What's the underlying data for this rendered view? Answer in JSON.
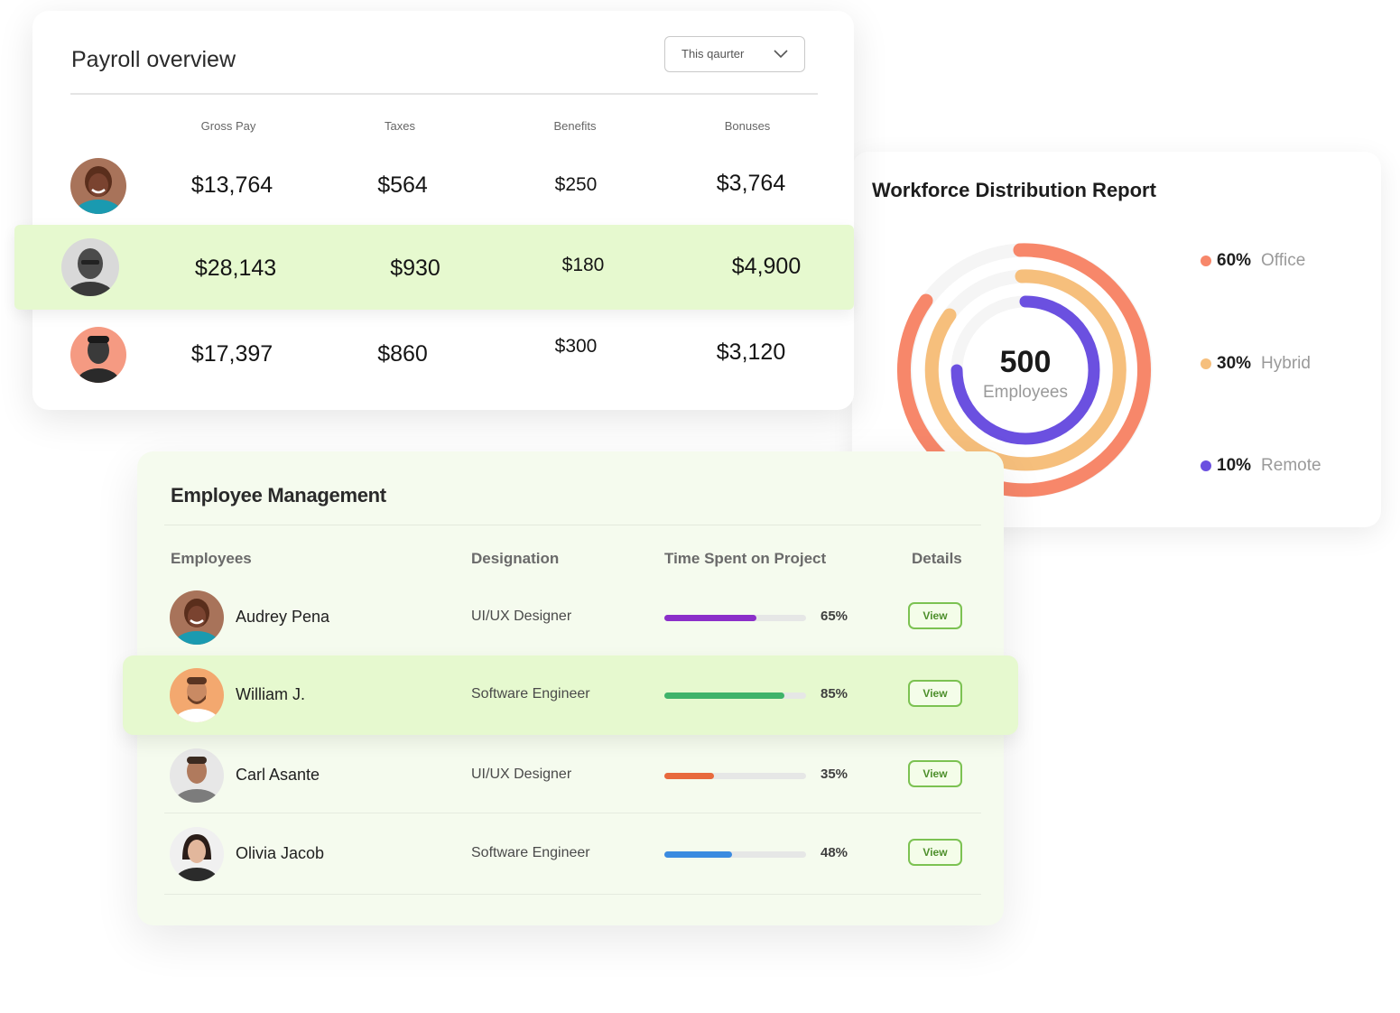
{
  "payroll": {
    "title": "Payroll overview",
    "period_select": "This qaurter",
    "columns": [
      "Gross Pay",
      "Taxes",
      "Benefits",
      "Bonuses"
    ],
    "rows": [
      {
        "gross": "$13,764",
        "taxes": "$564",
        "benefits": "$250",
        "bonuses": "$3,764"
      },
      {
        "gross": "$28,143",
        "taxes": "$930",
        "benefits": "$180",
        "bonuses": "$4,900"
      },
      {
        "gross": "$17,397",
        "taxes": "$860",
        "benefits": "$300",
        "bonuses": "$3,120"
      }
    ]
  },
  "workforce": {
    "title": "Workforce Distribution Report",
    "total": "500",
    "total_label": "Employees",
    "segments": [
      {
        "pct": "60%",
        "label": "Office",
        "value": 60,
        "color": "#f7876a"
      },
      {
        "pct": "30%",
        "label": "Hybrid",
        "value": 30,
        "color": "#f6bf7c"
      },
      {
        "pct": "10%",
        "label": "Remote",
        "value": 10,
        "color": "#6b50e0"
      }
    ]
  },
  "employees": {
    "title": "Employee Management",
    "columns": {
      "employees": "Employees",
      "designation": "Designation",
      "time": "Time Spent on Project",
      "details": "Details"
    },
    "rows": [
      {
        "name": "Audrey Pena",
        "designation": "UI/UX Designer",
        "progress": 65,
        "pct": "65%",
        "action": "View",
        "bar_color": "#8b2fc9"
      },
      {
        "name": "William J.",
        "designation": "Software Engineer",
        "progress": 85,
        "pct": "85%",
        "action": "View",
        "bar_color": "#3fb36a"
      },
      {
        "name": "Carl Asante",
        "designation": "UI/UX Designer",
        "progress": 35,
        "pct": "35%",
        "action": "View",
        "bar_color": "#e8693d"
      },
      {
        "name": "Olivia Jacob",
        "designation": "Software Engineer",
        "progress": 48,
        "pct": "48%",
        "action": "View",
        "bar_color": "#3b8be0"
      }
    ]
  }
}
